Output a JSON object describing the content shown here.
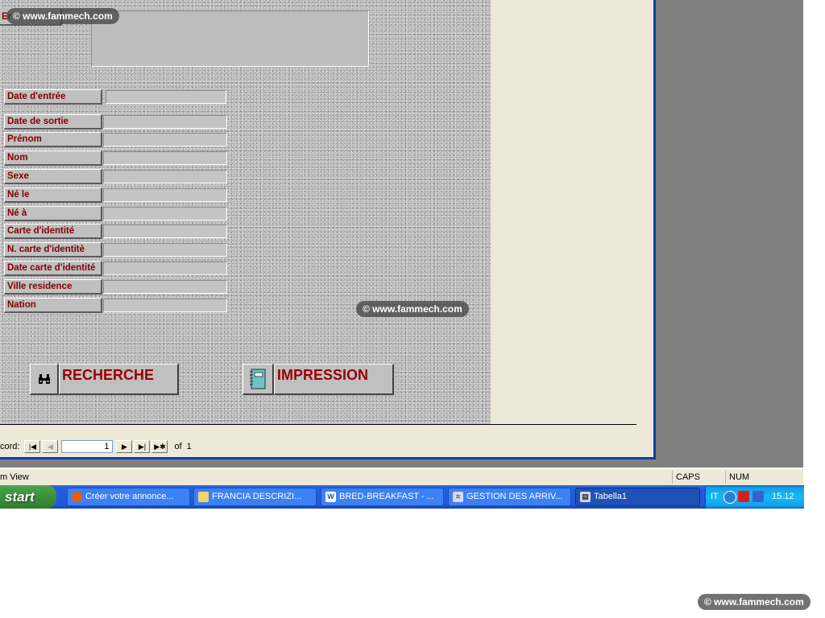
{
  "form": {
    "top_label": "Er",
    "fields": [
      {
        "label": "Date d'entrée"
      },
      {
        "label": "Date de sortie"
      },
      {
        "label": "Prénom"
      },
      {
        "label": "Nom"
      },
      {
        "label": "Sexe"
      },
      {
        "label": "Né le"
      },
      {
        "label": "Né à"
      },
      {
        "label": "Carte d'identité"
      },
      {
        "label": "N. carte d'identitè"
      },
      {
        "label": "Date carte d'identité"
      },
      {
        "label": "Ville residence"
      },
      {
        "label": "Nation"
      }
    ],
    "buttons": {
      "search_label": "RECHERCHE",
      "print_label": "IMPRESSION"
    }
  },
  "navigator": {
    "record_label": "cord:",
    "current_record": "1",
    "of_label": "of",
    "total_records": "1"
  },
  "statusbar": {
    "view_text": "m View",
    "caps": "CAPS",
    "num": "NUM"
  },
  "taskbar": {
    "start_label": "start",
    "tasks": [
      {
        "label": "Créer votre annonce..."
      },
      {
        "label": "FRANCIA DESCRIZI..."
      },
      {
        "label": "BRED-BREAKFAST - ..."
      },
      {
        "label": "GESTION DES ARRIV..."
      },
      {
        "label": "Tabella1"
      }
    ],
    "language": "IT",
    "clock": "15.12"
  },
  "watermark": "© www.fammech.com",
  "colors": {
    "label_text": "#800000",
    "button_text": "#9b0000",
    "window_border": "#0a3ea8",
    "taskbar": "#245edb"
  }
}
